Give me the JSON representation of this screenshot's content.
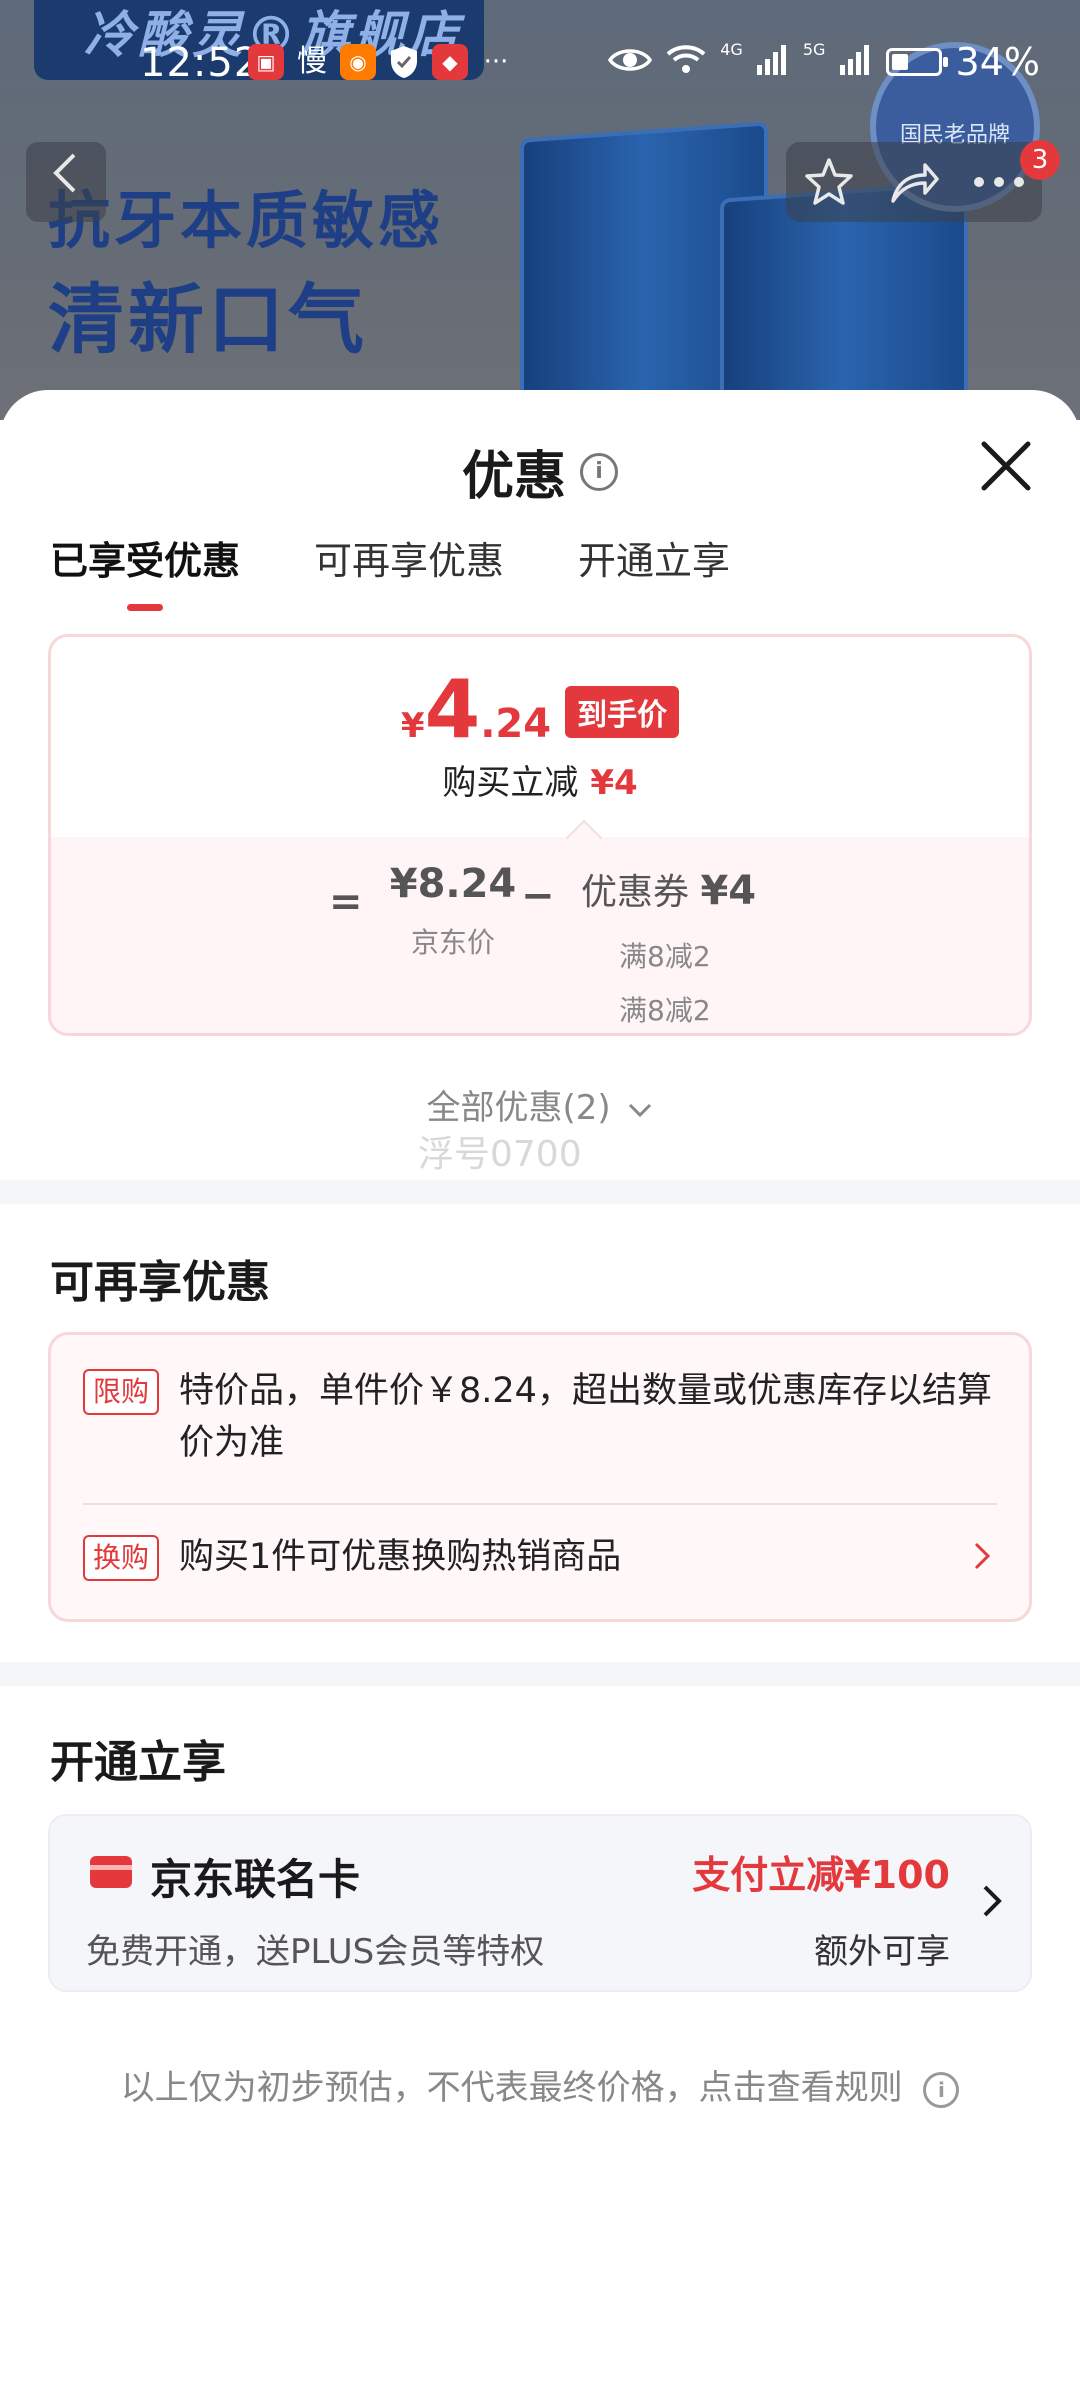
{
  "status_bar": {
    "time": "12:52",
    "notif_label": "慢",
    "more": "···",
    "net1": "4G",
    "net2": "5G",
    "battery": "34%"
  },
  "background": {
    "shop_name": "冷酸灵®旗舰店",
    "slogan_line1": "抗牙本质敏感",
    "slogan_line2": "清新口气",
    "badge_text": "国民老品牌"
  },
  "nav": {
    "cart_count": "3"
  },
  "sheet": {
    "title": "优惠",
    "tabs": [
      {
        "label": "已享受优惠",
        "active": true
      },
      {
        "label": "可再享优惠",
        "active": false
      },
      {
        "label": "开通立享",
        "active": false
      }
    ]
  },
  "price_card": {
    "currency": "¥",
    "final_int": "4",
    "final_dec": ".24",
    "final_tag": "到手价",
    "reduce_label": "购买立减",
    "reduce_value": "¥4",
    "equals": "=",
    "base_price": "¥8.24",
    "base_label": "京东价",
    "minus": "−",
    "coupon_label": "优惠券",
    "coupon_value": "¥4",
    "coupon_rules": [
      "满8减2",
      "满8减2"
    ]
  },
  "all_offers": "全部优惠(2)",
  "watermark": "浮号0700",
  "more_offers": {
    "title": "可再享优惠",
    "items": [
      {
        "tag": "限购",
        "text": "特价品，单件价￥8.24，超出数量或优惠库存以结算价为准"
      },
      {
        "tag": "换购",
        "text": "购买1件可优惠换购热销商品"
      }
    ]
  },
  "open_offers": {
    "title": "开通立享",
    "card_name": "京东联名卡",
    "card_desc": "免费开通，送PLUS会员等特权",
    "benefit": "支付立减¥100",
    "benefit_sub": "额外可享"
  },
  "footer": "以上仅为初步预估，不代表最终价格，点击查看规则",
  "colors": {
    "accent_red": "#e4393c",
    "card_border": "#f8d7da"
  }
}
